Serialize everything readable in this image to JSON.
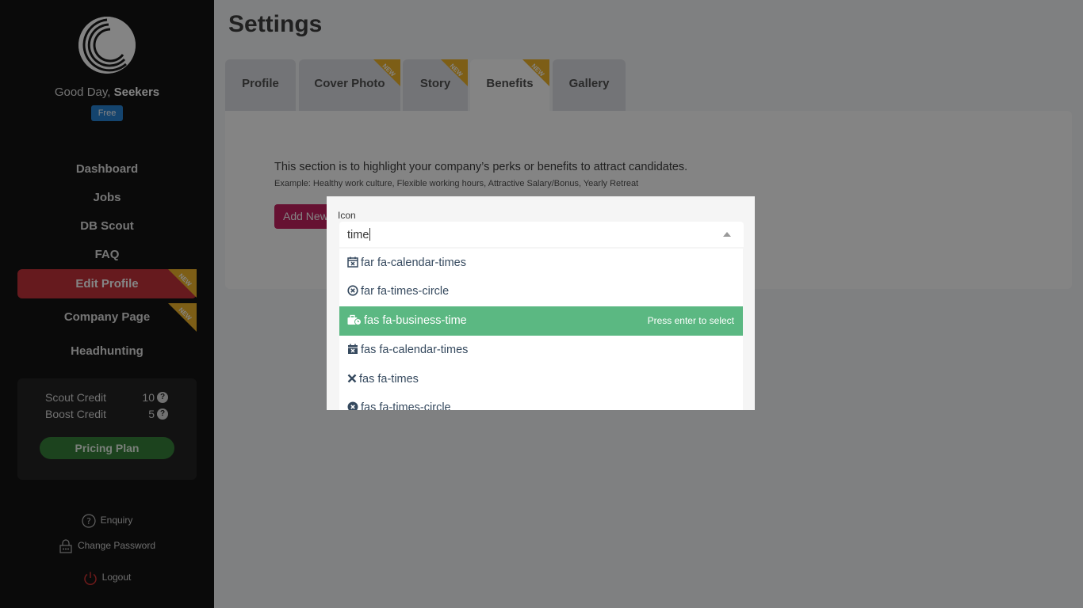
{
  "sidebar": {
    "greeting_prefix": "Good Day,",
    "username": "Seekers",
    "plan_badge": "Free",
    "nav": [
      {
        "label": "Dashboard"
      },
      {
        "label": "Jobs"
      },
      {
        "label": "DB Scout"
      },
      {
        "label": "FAQ"
      },
      {
        "label": "Edit Profile",
        "badge": "NEW",
        "active": true
      },
      {
        "label": "Company Page",
        "badge": "NEW"
      },
      {
        "label": "Headhunting"
      }
    ],
    "credits": {
      "scout_label": "Scout Credit",
      "scout_value": "10",
      "boost_label": "Boost Credit",
      "boost_value": "5",
      "pricing_button": "Pricing Plan"
    },
    "bottom_links": {
      "enquiry": "Enquiry",
      "change_password": "Change Password",
      "logout": "Logout"
    },
    "colors": {
      "active_nav": "#c22a33",
      "new_ribbon": "#f0b323",
      "pricing": "#2f7d32",
      "plan_badge": "#1f7fd3"
    }
  },
  "main": {
    "title": "Settings",
    "tabs": [
      {
        "label": "Profile"
      },
      {
        "label": "Cover Photo",
        "badge": "NEW"
      },
      {
        "label": "Story",
        "badge": "NEW"
      },
      {
        "label": "Benefits",
        "badge": "NEW",
        "active": true
      },
      {
        "label": "Gallery"
      }
    ],
    "benefits": {
      "description": "This section is to highlight your company’s perks or benefits to attract candidates.",
      "example": "Example: Healthy work culture, Flexible working hours, Attractive Salary/Bonus, Yearly Retreat",
      "add_button": "Add New Benefit"
    }
  },
  "modal": {
    "field_label": "Icon",
    "search_value": "time",
    "highlight_hint": "Press enter to select",
    "options": [
      {
        "label": "far fa-calendar-times",
        "icon": "calendar-times-outline-icon"
      },
      {
        "label": "far fa-times-circle",
        "icon": "times-circle-outline-icon"
      },
      {
        "label": "fas fa-business-time",
        "icon": "business-time-icon",
        "highlighted": true
      },
      {
        "label": "fas fa-calendar-times",
        "icon": "calendar-times-solid-icon"
      },
      {
        "label": "fas fa-times",
        "icon": "times-icon"
      },
      {
        "label": "fas fa-times-circle",
        "icon": "times-circle-solid-icon"
      }
    ],
    "colors": {
      "highlight": "#5bb882"
    }
  }
}
